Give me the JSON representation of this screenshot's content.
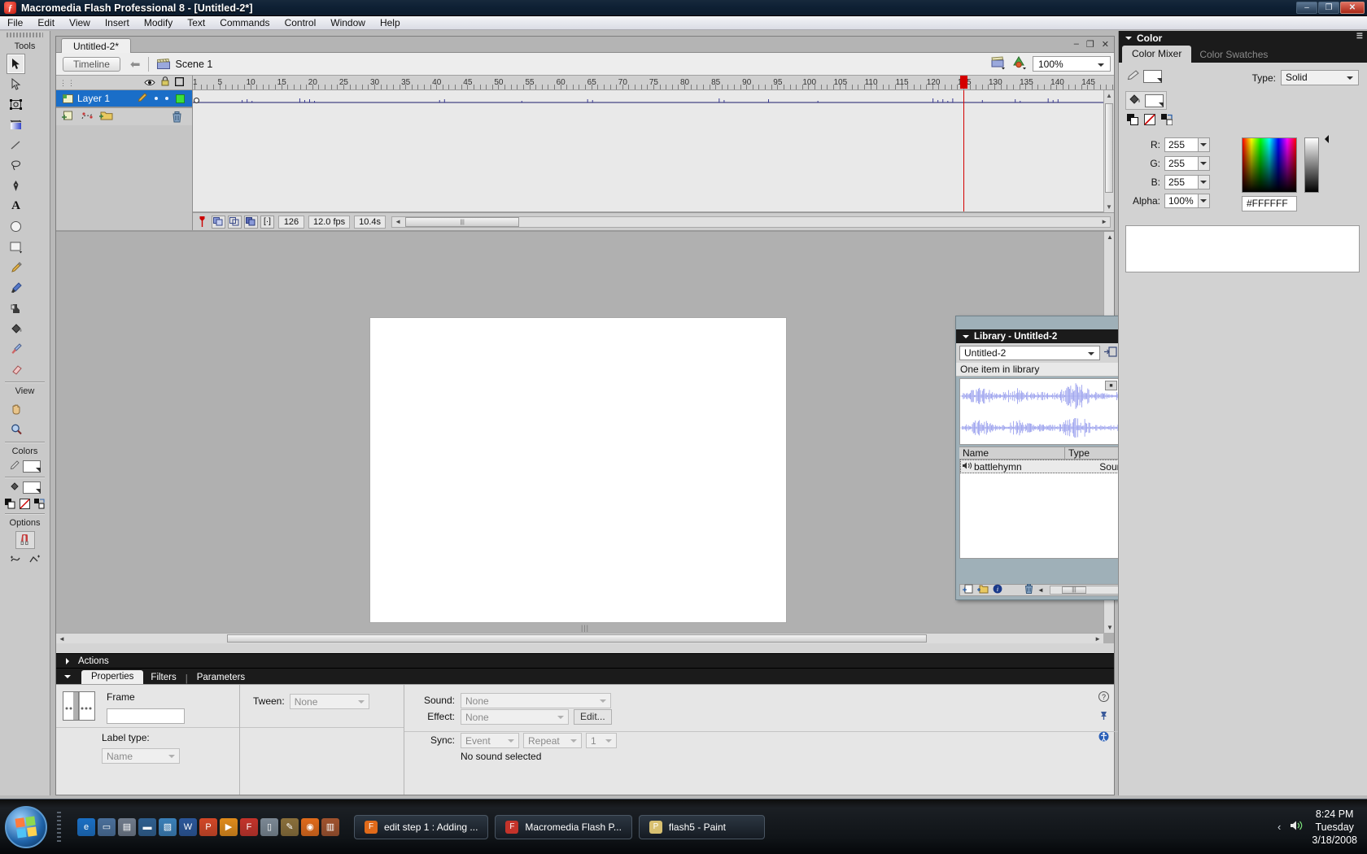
{
  "window": {
    "title": "Macromedia Flash Professional 8 - [Untitled-2*]",
    "app_icon": "flash-icon",
    "minimize": "–",
    "restore": "❐",
    "close": "✕"
  },
  "menubar": {
    "items": [
      "File",
      "Edit",
      "View",
      "Insert",
      "Modify",
      "Text",
      "Commands",
      "Control",
      "Window",
      "Help"
    ]
  },
  "toolbox": {
    "sections": {
      "tools_label": "Tools",
      "view_label": "View",
      "colors_label": "Colors",
      "options_label": "Options"
    },
    "tools": [
      {
        "name": "arrow-selection-tool",
        "selected": true
      },
      {
        "name": "subselection-tool",
        "selected": false
      },
      {
        "name": "free-transform-tool",
        "selected": false
      },
      {
        "name": "gradient-transform-tool",
        "selected": false
      },
      {
        "name": "line-tool",
        "selected": false
      },
      {
        "name": "lasso-tool",
        "selected": false
      },
      {
        "name": "pen-tool",
        "selected": false
      },
      {
        "name": "text-tool",
        "selected": false
      },
      {
        "name": "oval-tool",
        "selected": false
      },
      {
        "name": "rectangle-tool",
        "selected": false
      },
      {
        "name": "pencil-tool",
        "selected": false
      },
      {
        "name": "brush-tool",
        "selected": false
      },
      {
        "name": "ink-bottle-tool",
        "selected": false
      },
      {
        "name": "paint-bucket-tool",
        "selected": false
      },
      {
        "name": "eyedropper-tool",
        "selected": false
      },
      {
        "name": "eraser-tool",
        "selected": false
      }
    ],
    "view_tools": [
      {
        "name": "hand-tool"
      },
      {
        "name": "zoom-tool"
      }
    ],
    "color_controls": {
      "stroke_color": "#000000",
      "fill_color": "#FFFFFF",
      "black_white_label": "black-and-white-icon",
      "no_color_label": "no-color-icon",
      "swap_label": "swap-colors-icon"
    },
    "options": [
      {
        "name": "snap-to-objects-toggle"
      },
      {
        "name": "smooth-option"
      },
      {
        "name": "straighten-option"
      }
    ]
  },
  "document": {
    "tab_label": "Untitled-2*",
    "win_minimize": "–",
    "win_restore": "❐",
    "win_close": "✕"
  },
  "timeline": {
    "button_label": "Timeline",
    "back_arrow": "back-arrow-icon",
    "scene_label": "Scene 1",
    "scene_icon": "scene-clapper-icon",
    "edit_scene_icon": "edit-scene-icon",
    "edit_symbol_icon": "edit-symbol-icon",
    "zoom_value": "100%",
    "ruler_labels": [
      "1",
      "5",
      "10",
      "15",
      "20",
      "25",
      "30",
      "35",
      "40",
      "45",
      "50",
      "55",
      "60",
      "65",
      "70",
      "75",
      "80",
      "85",
      "90",
      "95",
      "100",
      "105",
      "110",
      "115",
      "120",
      "125",
      "130",
      "135",
      "140",
      "145"
    ],
    "playhead_frame": 125,
    "header_icons": [
      {
        "name": "eye-visibility-icon"
      },
      {
        "name": "lock-icon"
      },
      {
        "name": "outline-square-icon"
      }
    ],
    "layers": [
      {
        "name": "Layer 1",
        "selected": true,
        "pencil": "pencil-edit-icon",
        "visible_dot": "•",
        "lock_dot": "•",
        "outline_color": "#3CE03C"
      }
    ],
    "layer_buttons": [
      {
        "name": "insert-layer-button"
      },
      {
        "name": "add-motion-guide-button"
      },
      {
        "name": "insert-layer-folder-button"
      },
      {
        "name": "delete-layer-button"
      }
    ],
    "footer": {
      "center_frame_icon": "center-frame-icon",
      "onion_skin_icon": "onion-skin-icon",
      "onion_skin_outlines_icon": "onion-skin-outlines-icon",
      "edit_multiple_frames_icon": "edit-multiple-frames-icon",
      "modify_onion_markers_icon": "modify-onion-markers-icon",
      "current_frame": "126",
      "frame_rate": "12.0 fps",
      "elapsed_time": "10.4s"
    }
  },
  "stage": {
    "background": "#FFFFFF",
    "grip": "grip-handle"
  },
  "library": {
    "title": "Library - Untitled-2",
    "close_label": "✕",
    "menu_icon": "panel-menu-icon",
    "document_select": "Untitled-2",
    "pin_icon": "pin-library-icon",
    "new_library_panel_icon": "new-library-panel-icon",
    "item_count_label": "One item in library",
    "preview_stop_icon": "stop-button-icon",
    "preview_play_icon": "play-button-icon",
    "columns": [
      "Name",
      "Type"
    ],
    "sort_icon": "sort-order-icon",
    "items": [
      {
        "icon": "sound-icon",
        "name": "battlehymn",
        "type": "Sound",
        "selected": true
      }
    ],
    "footer_buttons": [
      {
        "name": "new-symbol-button"
      },
      {
        "name": "new-folder-button"
      },
      {
        "name": "properties-button"
      },
      {
        "name": "delete-button"
      }
    ]
  },
  "color_panel": {
    "title": "Color",
    "grip_icon": "panel-options-icon",
    "tabs": [
      {
        "label": "Color Mixer",
        "active": true
      },
      {
        "label": "Color Swatches",
        "active": false
      }
    ],
    "type_label": "Type:",
    "type_value": "Solid",
    "stroke_icon": "stroke-color-icon",
    "fill_icon": "fill-color-icon",
    "stroke_color": "#FFFFFF",
    "fill_color": "#FFFFFF",
    "mini_buttons": [
      {
        "name": "black-and-white-icon"
      },
      {
        "name": "no-color-icon"
      },
      {
        "name": "swap-colors-icon"
      }
    ],
    "fields": [
      {
        "label": "R:",
        "value": "255"
      },
      {
        "label": "G:",
        "value": "255"
      },
      {
        "label": "B:",
        "value": "255"
      },
      {
        "label": "Alpha:",
        "value": "100%"
      }
    ],
    "hex_value": "#FFFFFF"
  },
  "actions_panel": {
    "label": "Actions",
    "expander": "collapsed-triangle-icon"
  },
  "properties_panel": {
    "expander": "expanded-triangle-icon",
    "tabs": [
      {
        "label": "Properties",
        "active": true
      },
      {
        "label": "Filters",
        "active": false
      },
      {
        "label": "Parameters",
        "active": false
      }
    ],
    "frame_label": "Frame",
    "frame_value": "",
    "frame_placeholder": "",
    "label_type_label": "Label type:",
    "label_type_value": "Name",
    "tween_label": "Tween:",
    "tween_value": "None",
    "sound_label": "Sound:",
    "sound_value": "None",
    "effect_label": "Effect:",
    "effect_value": "None",
    "edit_button": "Edit...",
    "sync_label": "Sync:",
    "sync_value": "Event",
    "loop_value": "Repeat",
    "loop_count": "1",
    "status_text": "No sound selected",
    "help_icon": "help-icon",
    "pin_icon": "pin-icon",
    "info_icon": "accessibility-icon"
  },
  "taskbar": {
    "start_label": "start-orb",
    "quick_launch": [
      {
        "name": "internet-explorer-icon",
        "glyph": "e",
        "color": "#1a6fc4"
      },
      {
        "name": "show-desktop-icon",
        "glyph": "▭",
        "color": "#4a6f9a"
      },
      {
        "name": "windows-explorer-icon",
        "glyph": "▤",
        "color": "#6f7a8a"
      },
      {
        "name": "media-center-icon",
        "glyph": "▬",
        "color": "#2f5f8f"
      },
      {
        "name": "switch-windows-icon",
        "glyph": "▧",
        "color": "#3a7fb8"
      },
      {
        "name": "word-icon",
        "glyph": "W",
        "color": "#2a5699"
      },
      {
        "name": "powerpoint-icon",
        "glyph": "P",
        "color": "#d24726"
      },
      {
        "name": "media-player-icon",
        "glyph": "▶",
        "color": "#e08b1a"
      },
      {
        "name": "flash-icon",
        "glyph": "F",
        "color": "#c4332a"
      },
      {
        "name": "recycle-bin-icon",
        "glyph": "▯",
        "color": "#7b8894"
      },
      {
        "name": "paint-icon",
        "glyph": "✎",
        "color": "#8a6f3a"
      },
      {
        "name": "firefox-icon",
        "glyph": "◉",
        "color": "#e06a1a"
      },
      {
        "name": "movie-maker-icon",
        "glyph": "▥",
        "color": "#a0522d"
      }
    ],
    "tasks": [
      {
        "icon": "firefox-icon",
        "label": "edit step 1 : Adding ...",
        "color": "#e06a1a"
      },
      {
        "icon": "flash-icon",
        "label": "Macromedia Flash P...",
        "color": "#c4332a"
      },
      {
        "icon": "paint-icon",
        "label": "flash5 - Paint",
        "color": "#d8c070"
      }
    ],
    "tray": {
      "expand_arrow": "‹",
      "volume_icon": "volume-icon",
      "time": "8:24 PM",
      "day": "Tuesday",
      "date": "3/18/2008"
    }
  }
}
